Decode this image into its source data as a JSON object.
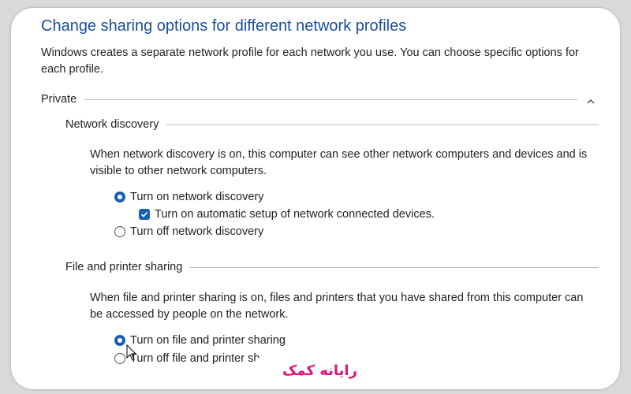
{
  "header": {
    "title": "Change sharing options for different network profiles",
    "description": "Windows creates a separate network profile for each network you use. You can choose specific options for each profile."
  },
  "profile": {
    "label": "Private",
    "collapse_icon": "chevron-up-icon"
  },
  "network_discovery": {
    "label": "Network discovery",
    "description": "When network discovery is on, this computer can see other network computers and devices and is visible to other network computers.",
    "option_on": "Turn on network discovery",
    "option_auto": "Turn on automatic setup of network connected devices.",
    "option_off": "Turn off network discovery",
    "selected": "on",
    "auto_setup_checked": true
  },
  "file_sharing": {
    "label": "File and printer sharing",
    "description": "When file and printer sharing is on, files and printers that you have shared from this computer can be accessed by people on the network.",
    "option_on": "Turn on file and printer sharing",
    "option_off": "Turn off file and printer sharing",
    "selected": "on"
  },
  "watermark": {
    "text": "رایانه کمک",
    "color": "#e0137c"
  },
  "colors": {
    "accent": "#1a5fb4",
    "title": "#1a4f9c"
  }
}
